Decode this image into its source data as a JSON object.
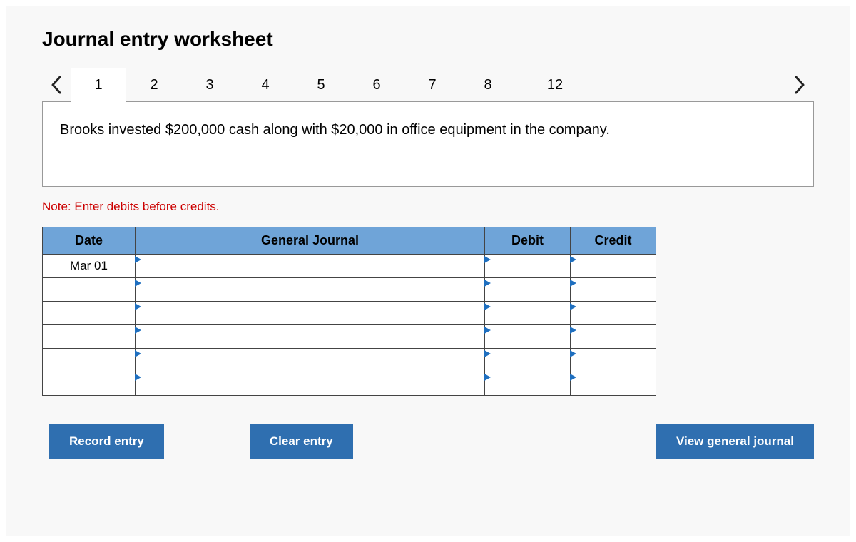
{
  "title": "Journal entry worksheet",
  "tabs": [
    "1",
    "2",
    "3",
    "4",
    "5",
    "6",
    "7",
    "8",
    "12"
  ],
  "active_tab_index": 0,
  "prompt": "Brooks invested $200,000 cash along with $20,000 in office equipment in the company.",
  "note": "Note: Enter debits before credits.",
  "table": {
    "headers": {
      "date": "Date",
      "journal": "General Journal",
      "debit": "Debit",
      "credit": "Credit"
    },
    "rows": [
      {
        "date": "Mar 01",
        "journal": "",
        "debit": "",
        "credit": ""
      },
      {
        "date": "",
        "journal": "",
        "debit": "",
        "credit": ""
      },
      {
        "date": "",
        "journal": "",
        "debit": "",
        "credit": ""
      },
      {
        "date": "",
        "journal": "",
        "debit": "",
        "credit": ""
      },
      {
        "date": "",
        "journal": "",
        "debit": "",
        "credit": ""
      },
      {
        "date": "",
        "journal": "",
        "debit": "",
        "credit": ""
      }
    ]
  },
  "buttons": {
    "record": "Record entry",
    "clear": "Clear entry",
    "view": "View general journal"
  }
}
